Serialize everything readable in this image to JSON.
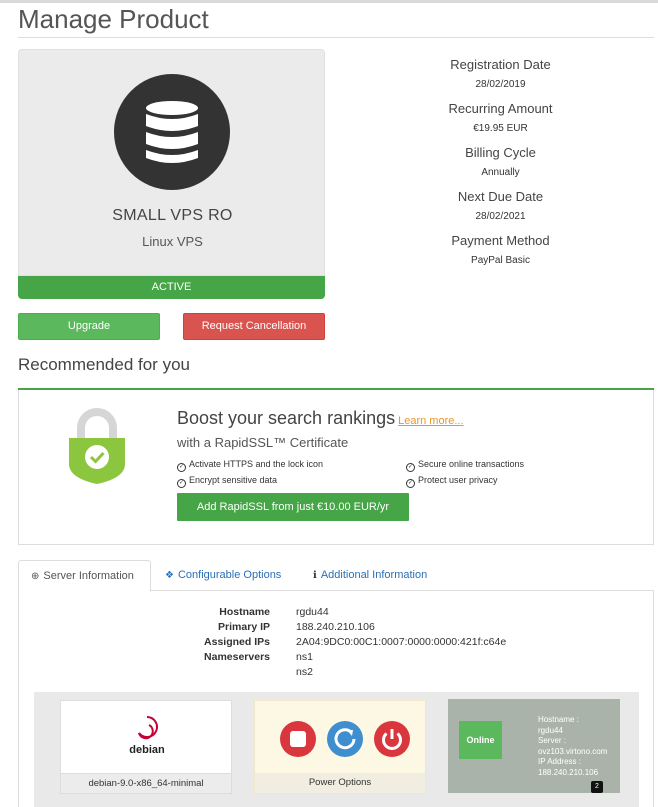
{
  "page": {
    "title": "Manage Product"
  },
  "product": {
    "name": "SMALL VPS RO",
    "group": "Linux VPS",
    "status": "ACTIVE",
    "icon": "database-icon"
  },
  "details": {
    "items": [
      {
        "label": "Registration Date",
        "value": "28/02/2019"
      },
      {
        "label": "Recurring Amount",
        "value": "€19.95 EUR"
      },
      {
        "label": "Billing Cycle",
        "value": "Annually"
      },
      {
        "label": "Next Due Date",
        "value": "28/02/2021"
      },
      {
        "label": "Payment Method",
        "value": "PayPal Basic"
      }
    ]
  },
  "actions": {
    "upgrade": "Upgrade",
    "cancel": "Request Cancellation"
  },
  "recommended": {
    "section_title": "Recommended for you",
    "headline": "Boost your search rankings",
    "learn_more": "Learn more...",
    "subtitle": "with a RapidSSL™ Certificate",
    "features": [
      "Activate HTTPS and the lock icon",
      "Secure online transactions",
      "Encrypt sensitive data",
      "Protect user privacy"
    ],
    "button": "Add RapidSSL from just €10.00 EUR/yr"
  },
  "tabs": [
    {
      "label": "Server Information",
      "icon": "globe-icon"
    },
    {
      "label": "Configurable Options",
      "icon": "cubes-icon"
    },
    {
      "label": "Additional Information",
      "icon": "info-icon"
    }
  ],
  "server_info": {
    "rows": [
      {
        "label": "Hostname",
        "value": "rgdu44"
      },
      {
        "label": "Primary IP",
        "value": "188.240.210.106"
      },
      {
        "label": "Assigned IPs",
        "value": "2A04:9DC0:00C1:0007:0000:0000:421f:c64e"
      },
      {
        "label": "Nameservers",
        "value": "ns1"
      },
      {
        "label": "",
        "value": "ns2"
      }
    ]
  },
  "vps": {
    "os_logo_text": "debian",
    "os_name": "debian-9.0-x86_64-minimal",
    "power_label": "Power Options",
    "status": "Online",
    "info_lines": [
      "Hostname :",
      "rgdu44",
      "Server :",
      "ovz103.virtono.com",
      "IP Address :",
      "188.240.210.106"
    ],
    "page_badge": "2"
  },
  "colors": {
    "success": "#46a546",
    "danger": "#d9534f",
    "link": "#2a6fb5",
    "ssl_shield": "#8cc63f"
  }
}
